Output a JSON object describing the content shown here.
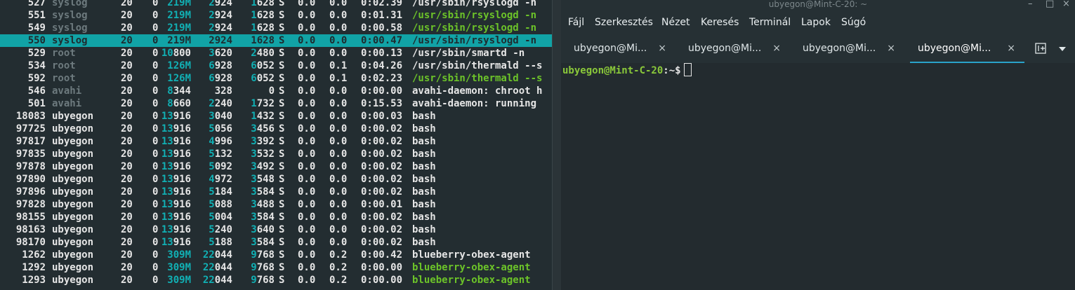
{
  "htop": {
    "rows": [
      {
        "pid": "527",
        "user": "syslog",
        "pri": "20",
        "ni": "0",
        "virt": "219M",
        "res": "2924",
        "shr": "1628",
        "s": "S",
        "cpu": "0.0",
        "mem": "0.0",
        "time": "0:02.39",
        "cmd": "/usr/sbin/rsyslogd -n",
        "userDim": true,
        "cmdColor": "white"
      },
      {
        "pid": "551",
        "user": "syslog",
        "pri": "20",
        "ni": "0",
        "virt": "219M",
        "res": "2924",
        "shr": "1628",
        "s": "S",
        "cpu": "0.0",
        "mem": "0.0",
        "time": "0:01.31",
        "cmd": "/usr/sbin/rsyslogd -n",
        "userDim": true,
        "cmdColor": "green"
      },
      {
        "pid": "549",
        "user": "syslog",
        "pri": "20",
        "ni": "0",
        "virt": "219M",
        "res": "2924",
        "shr": "1628",
        "s": "S",
        "cpu": "0.0",
        "mem": "0.0",
        "time": "0:00.58",
        "cmd": "/usr/sbin/rsyslogd -n",
        "userDim": true,
        "cmdColor": "green"
      },
      {
        "pid": "550",
        "user": "syslog",
        "pri": "20",
        "ni": "0",
        "virt": "219M",
        "res": "2924",
        "shr": "1628",
        "s": "S",
        "cpu": "0.0",
        "mem": "0.0",
        "time": "0:00.47",
        "cmd": "/usr/sbin/rsyslogd -n",
        "userDim": true,
        "cmdColor": "green",
        "selected": true
      },
      {
        "pid": "529",
        "user": "root",
        "pri": "20",
        "ni": "0",
        "virt": "10800",
        "res": "3620",
        "shr": "2480",
        "s": "S",
        "cpu": "0.0",
        "mem": "0.0",
        "time": "0:00.13",
        "cmd": "/usr/sbin/smartd -n",
        "userDim": true,
        "cmdColor": "white"
      },
      {
        "pid": "534",
        "user": "root",
        "pri": "20",
        "ni": "0",
        "virt": "126M",
        "res": "6928",
        "shr": "6052",
        "s": "S",
        "cpu": "0.0",
        "mem": "0.1",
        "time": "0:04.26",
        "cmd": "/usr/sbin/thermald --s",
        "userDim": true,
        "cmdColor": "white"
      },
      {
        "pid": "592",
        "user": "root",
        "pri": "20",
        "ni": "0",
        "virt": "126M",
        "res": "6928",
        "shr": "6052",
        "s": "S",
        "cpu": "0.0",
        "mem": "0.1",
        "time": "0:02.23",
        "cmd": "/usr/sbin/thermald --s",
        "userDim": true,
        "cmdColor": "green"
      },
      {
        "pid": "546",
        "user": "avahi",
        "pri": "20",
        "ni": "0",
        "virt": "8344",
        "res": "328",
        "shr": "0",
        "s": "S",
        "cpu": "0.0",
        "mem": "0.0",
        "time": "0:00.00",
        "cmd": "avahi-daemon: chroot h",
        "userDim": true,
        "cmdColor": "white"
      },
      {
        "pid": "501",
        "user": "avahi",
        "pri": "20",
        "ni": "0",
        "virt": "8660",
        "res": "2240",
        "shr": "1732",
        "s": "S",
        "cpu": "0.0",
        "mem": "0.0",
        "time": "0:15.53",
        "cmd": "avahi-daemon: running",
        "userDim": true,
        "cmdColor": "white"
      },
      {
        "pid": "18083",
        "user": "ubyegon",
        "pri": "20",
        "ni": "0",
        "virt": "13916",
        "res": "3040",
        "shr": "1432",
        "s": "S",
        "cpu": "0.0",
        "mem": "0.0",
        "time": "0:00.03",
        "cmd": "bash",
        "cmdColor": "white"
      },
      {
        "pid": "97725",
        "user": "ubyegon",
        "pri": "20",
        "ni": "0",
        "virt": "13916",
        "res": "5056",
        "shr": "3456",
        "s": "S",
        "cpu": "0.0",
        "mem": "0.0",
        "time": "0:00.02",
        "cmd": "bash",
        "cmdColor": "white"
      },
      {
        "pid": "97817",
        "user": "ubyegon",
        "pri": "20",
        "ni": "0",
        "virt": "13916",
        "res": "4996",
        "shr": "3392",
        "s": "S",
        "cpu": "0.0",
        "mem": "0.0",
        "time": "0:00.02",
        "cmd": "bash",
        "cmdColor": "white"
      },
      {
        "pid": "97835",
        "user": "ubyegon",
        "pri": "20",
        "ni": "0",
        "virt": "13916",
        "res": "5132",
        "shr": "3532",
        "s": "S",
        "cpu": "0.0",
        "mem": "0.0",
        "time": "0:00.02",
        "cmd": "bash",
        "cmdColor": "white"
      },
      {
        "pid": "97878",
        "user": "ubyegon",
        "pri": "20",
        "ni": "0",
        "virt": "13916",
        "res": "5092",
        "shr": "3492",
        "s": "S",
        "cpu": "0.0",
        "mem": "0.0",
        "time": "0:00.02",
        "cmd": "bash",
        "cmdColor": "white"
      },
      {
        "pid": "97890",
        "user": "ubyegon",
        "pri": "20",
        "ni": "0",
        "virt": "13916",
        "res": "4972",
        "shr": "3548",
        "s": "S",
        "cpu": "0.0",
        "mem": "0.0",
        "time": "0:00.02",
        "cmd": "bash",
        "cmdColor": "white"
      },
      {
        "pid": "97896",
        "user": "ubyegon",
        "pri": "20",
        "ni": "0",
        "virt": "13916",
        "res": "5184",
        "shr": "3584",
        "s": "S",
        "cpu": "0.0",
        "mem": "0.0",
        "time": "0:00.02",
        "cmd": "bash",
        "cmdColor": "white"
      },
      {
        "pid": "97828",
        "user": "ubyegon",
        "pri": "20",
        "ni": "0",
        "virt": "13916",
        "res": "5088",
        "shr": "3488",
        "s": "S",
        "cpu": "0.0",
        "mem": "0.0",
        "time": "0:00.01",
        "cmd": "bash",
        "cmdColor": "white"
      },
      {
        "pid": "98155",
        "user": "ubyegon",
        "pri": "20",
        "ni": "0",
        "virt": "13916",
        "res": "5004",
        "shr": "3584",
        "s": "S",
        "cpu": "0.0",
        "mem": "0.0",
        "time": "0:00.02",
        "cmd": "bash",
        "cmdColor": "white"
      },
      {
        "pid": "98163",
        "user": "ubyegon",
        "pri": "20",
        "ni": "0",
        "virt": "13916",
        "res": "5240",
        "shr": "3640",
        "s": "S",
        "cpu": "0.0",
        "mem": "0.0",
        "time": "0:00.02",
        "cmd": "bash",
        "cmdColor": "white"
      },
      {
        "pid": "98170",
        "user": "ubyegon",
        "pri": "20",
        "ni": "0",
        "virt": "13916",
        "res": "5188",
        "shr": "3584",
        "s": "S",
        "cpu": "0.0",
        "mem": "0.0",
        "time": "0:00.02",
        "cmd": "bash",
        "cmdColor": "white"
      },
      {
        "pid": "1262",
        "user": "ubyegon",
        "pri": "20",
        "ni": "0",
        "virt": "309M",
        "res": "22044",
        "shr": "9768",
        "s": "S",
        "cpu": "0.0",
        "mem": "0.2",
        "time": "0:00.42",
        "cmd": "blueberry-obex-agent",
        "cmdColor": "white"
      },
      {
        "pid": "1292",
        "user": "ubyegon",
        "pri": "20",
        "ni": "0",
        "virt": "309M",
        "res": "22044",
        "shr": "9768",
        "s": "S",
        "cpu": "0.0",
        "mem": "0.2",
        "time": "0:00.00",
        "cmd": "blueberry-obex-agent",
        "cmdColor": "green"
      },
      {
        "pid": "1293",
        "user": "ubyegon",
        "pri": "20",
        "ni": "0",
        "virt": "309M",
        "res": "22044",
        "shr": "9768",
        "s": "S",
        "cpu": "0.0",
        "mem": "0.2",
        "time": "0:00.00",
        "cmd": "blueberry-obex-agent",
        "cmdColor": "green"
      }
    ]
  },
  "terminal": {
    "window_title": "ubyegon@Mint-C-20: ~",
    "menu": [
      "Fájl",
      "Szerkesztés",
      "Nézet",
      "Keresés",
      "Terminál",
      "Lapok",
      "Súgó"
    ],
    "tabs": [
      {
        "label": "ubyegon@Mi...",
        "close": "×"
      },
      {
        "label": "ubyegon@Mi...",
        "close": "×"
      },
      {
        "label": "ubyegon@Mi...",
        "close": "×"
      },
      {
        "label": "ubyegon@Mi...",
        "close": "×",
        "active": true
      }
    ],
    "prompt_user": "ubyegon@Mint-C-20",
    "prompt_path": ":~$",
    "window_buttons": {
      "minimize": "–",
      "maximize": "□",
      "close": "×"
    },
    "tab_menu_glyph": "▾"
  },
  "colors": {
    "selection": "#11a3a6",
    "green": "#6cc329",
    "teal": "#11b0b4",
    "tab_underline": "#2aa3c9"
  }
}
